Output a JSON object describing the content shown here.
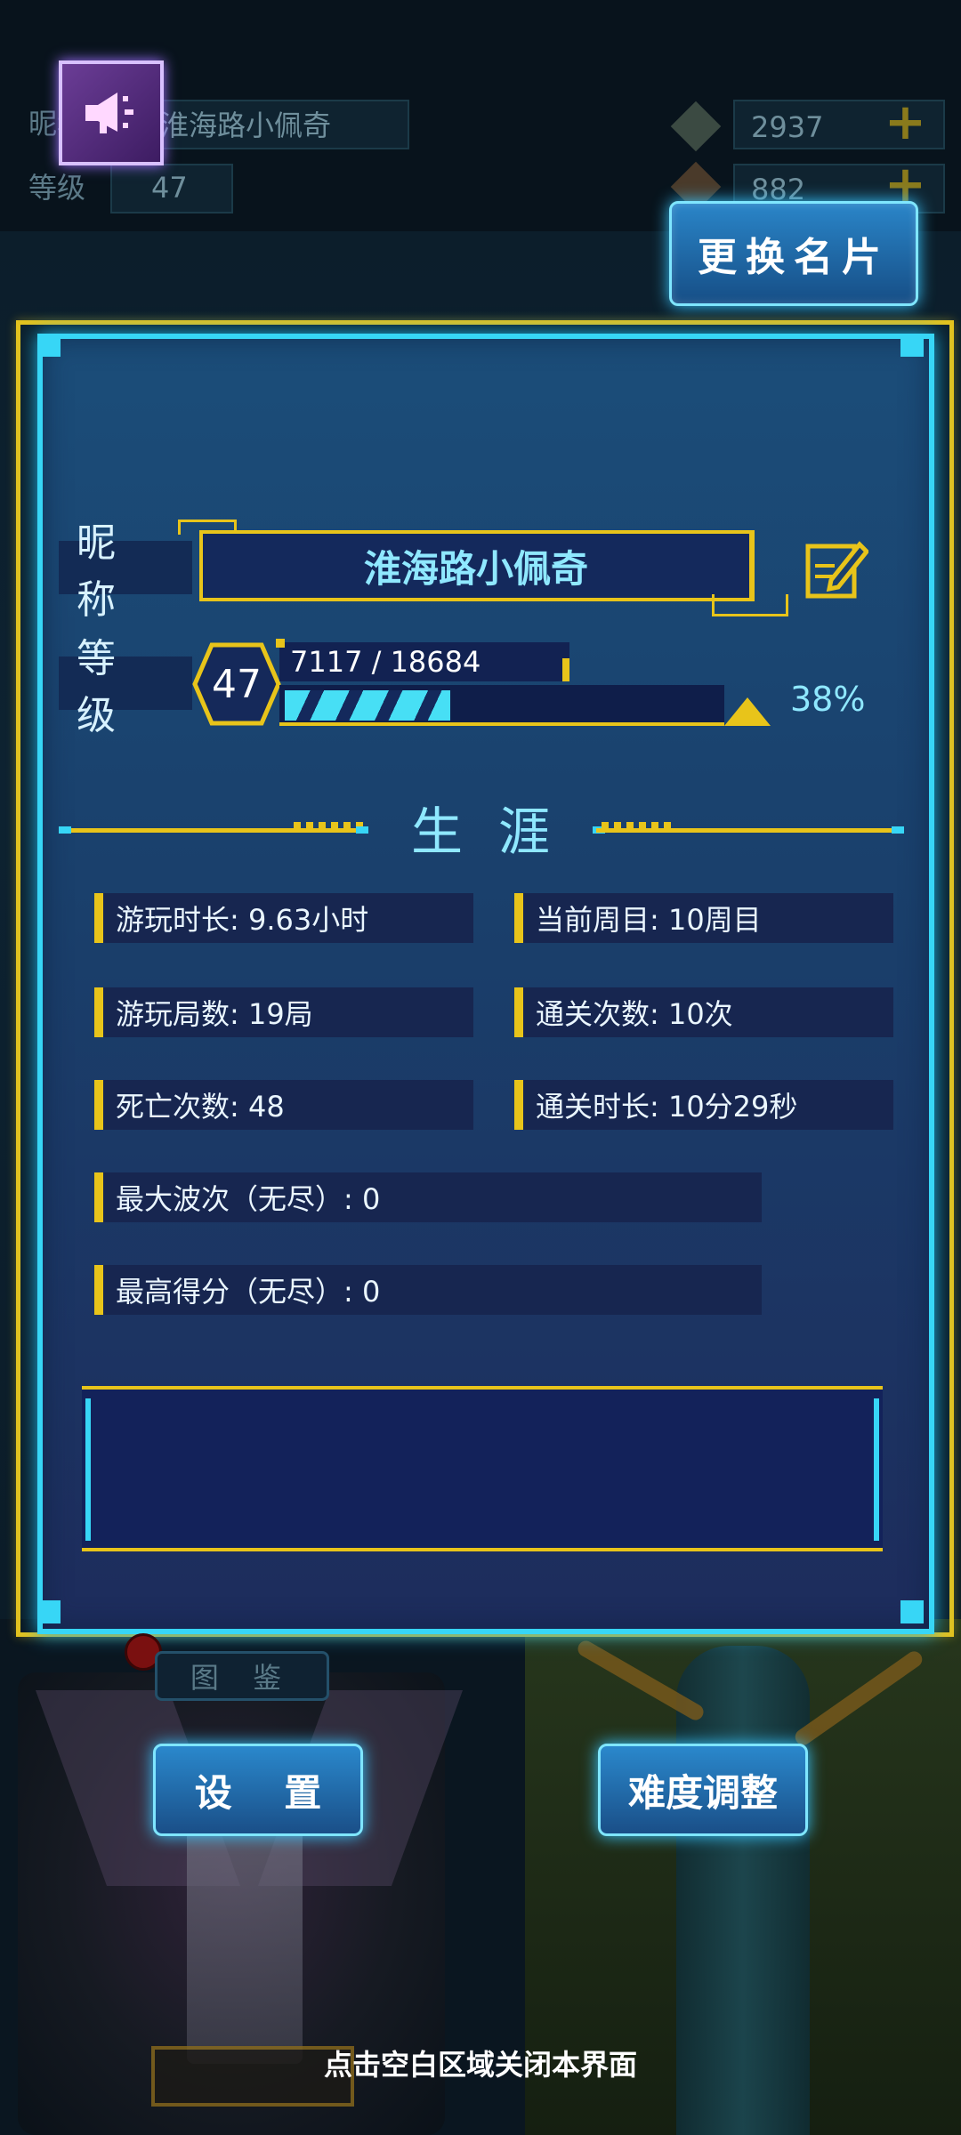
{
  "top_bar": {
    "nickname_label": "昵称",
    "nickname_value": "淮海路小佩奇",
    "level_label": "等级",
    "level_value": "47",
    "currency1": "2937",
    "currency2": "882",
    "change_card_button": "更换名片"
  },
  "profile": {
    "nickname_label": "昵 称",
    "nickname": "淮海路小佩奇",
    "level_label": "等 级",
    "level": "47",
    "xp_text": "7117 / 18684",
    "xp_current": 7117,
    "xp_max": 18684,
    "xp_percent_text": "38%"
  },
  "career": {
    "title": "生涯",
    "stats": [
      {
        "text": "游玩时长: 9.63小时"
      },
      {
        "text": "当前周目: 10周目"
      },
      {
        "text": "游玩局数: 19局"
      },
      {
        "text": "通关次数: 10次"
      },
      {
        "text": "死亡次数: 48"
      },
      {
        "text": "通关时长: 10分29秒"
      },
      {
        "text": "最大波次（无尽）: 0"
      },
      {
        "text": "最高得分（无尽）: 0"
      }
    ]
  },
  "bottom": {
    "tujian_label": "图 鉴",
    "settings_button": "设 置",
    "difficulty_button": "难度调整",
    "close_hint": "点击空白区域关闭本界面"
  },
  "colors": {
    "panel_border": "#37d6f6",
    "accent_gold": "#e8c41a",
    "panel_bg": "#1a3f6b"
  }
}
